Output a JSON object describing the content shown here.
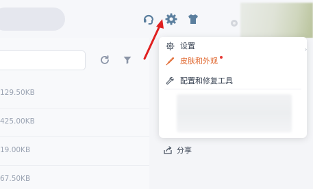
{
  "topbar": {
    "icons": [
      "headset-icon",
      "gear-icon",
      "shirt-icon"
    ]
  },
  "file_list": {
    "sizes": [
      "129.50KB",
      "425.00KB",
      "19.00KB",
      "67.50KB"
    ]
  },
  "menu": {
    "items": [
      {
        "label": "设置",
        "icon": "gear-icon"
      },
      {
        "label": "皮肤和外观",
        "icon": "brush-icon",
        "active": true,
        "has_dot": true
      },
      {
        "label": "配置和修复工具",
        "icon": "wrench-icon"
      }
    ]
  },
  "panel": {
    "share_label": "分享"
  },
  "colors": {
    "accent": "#e0662d",
    "arrow": "#e02020",
    "icon_blue": "#5b7f9e"
  }
}
